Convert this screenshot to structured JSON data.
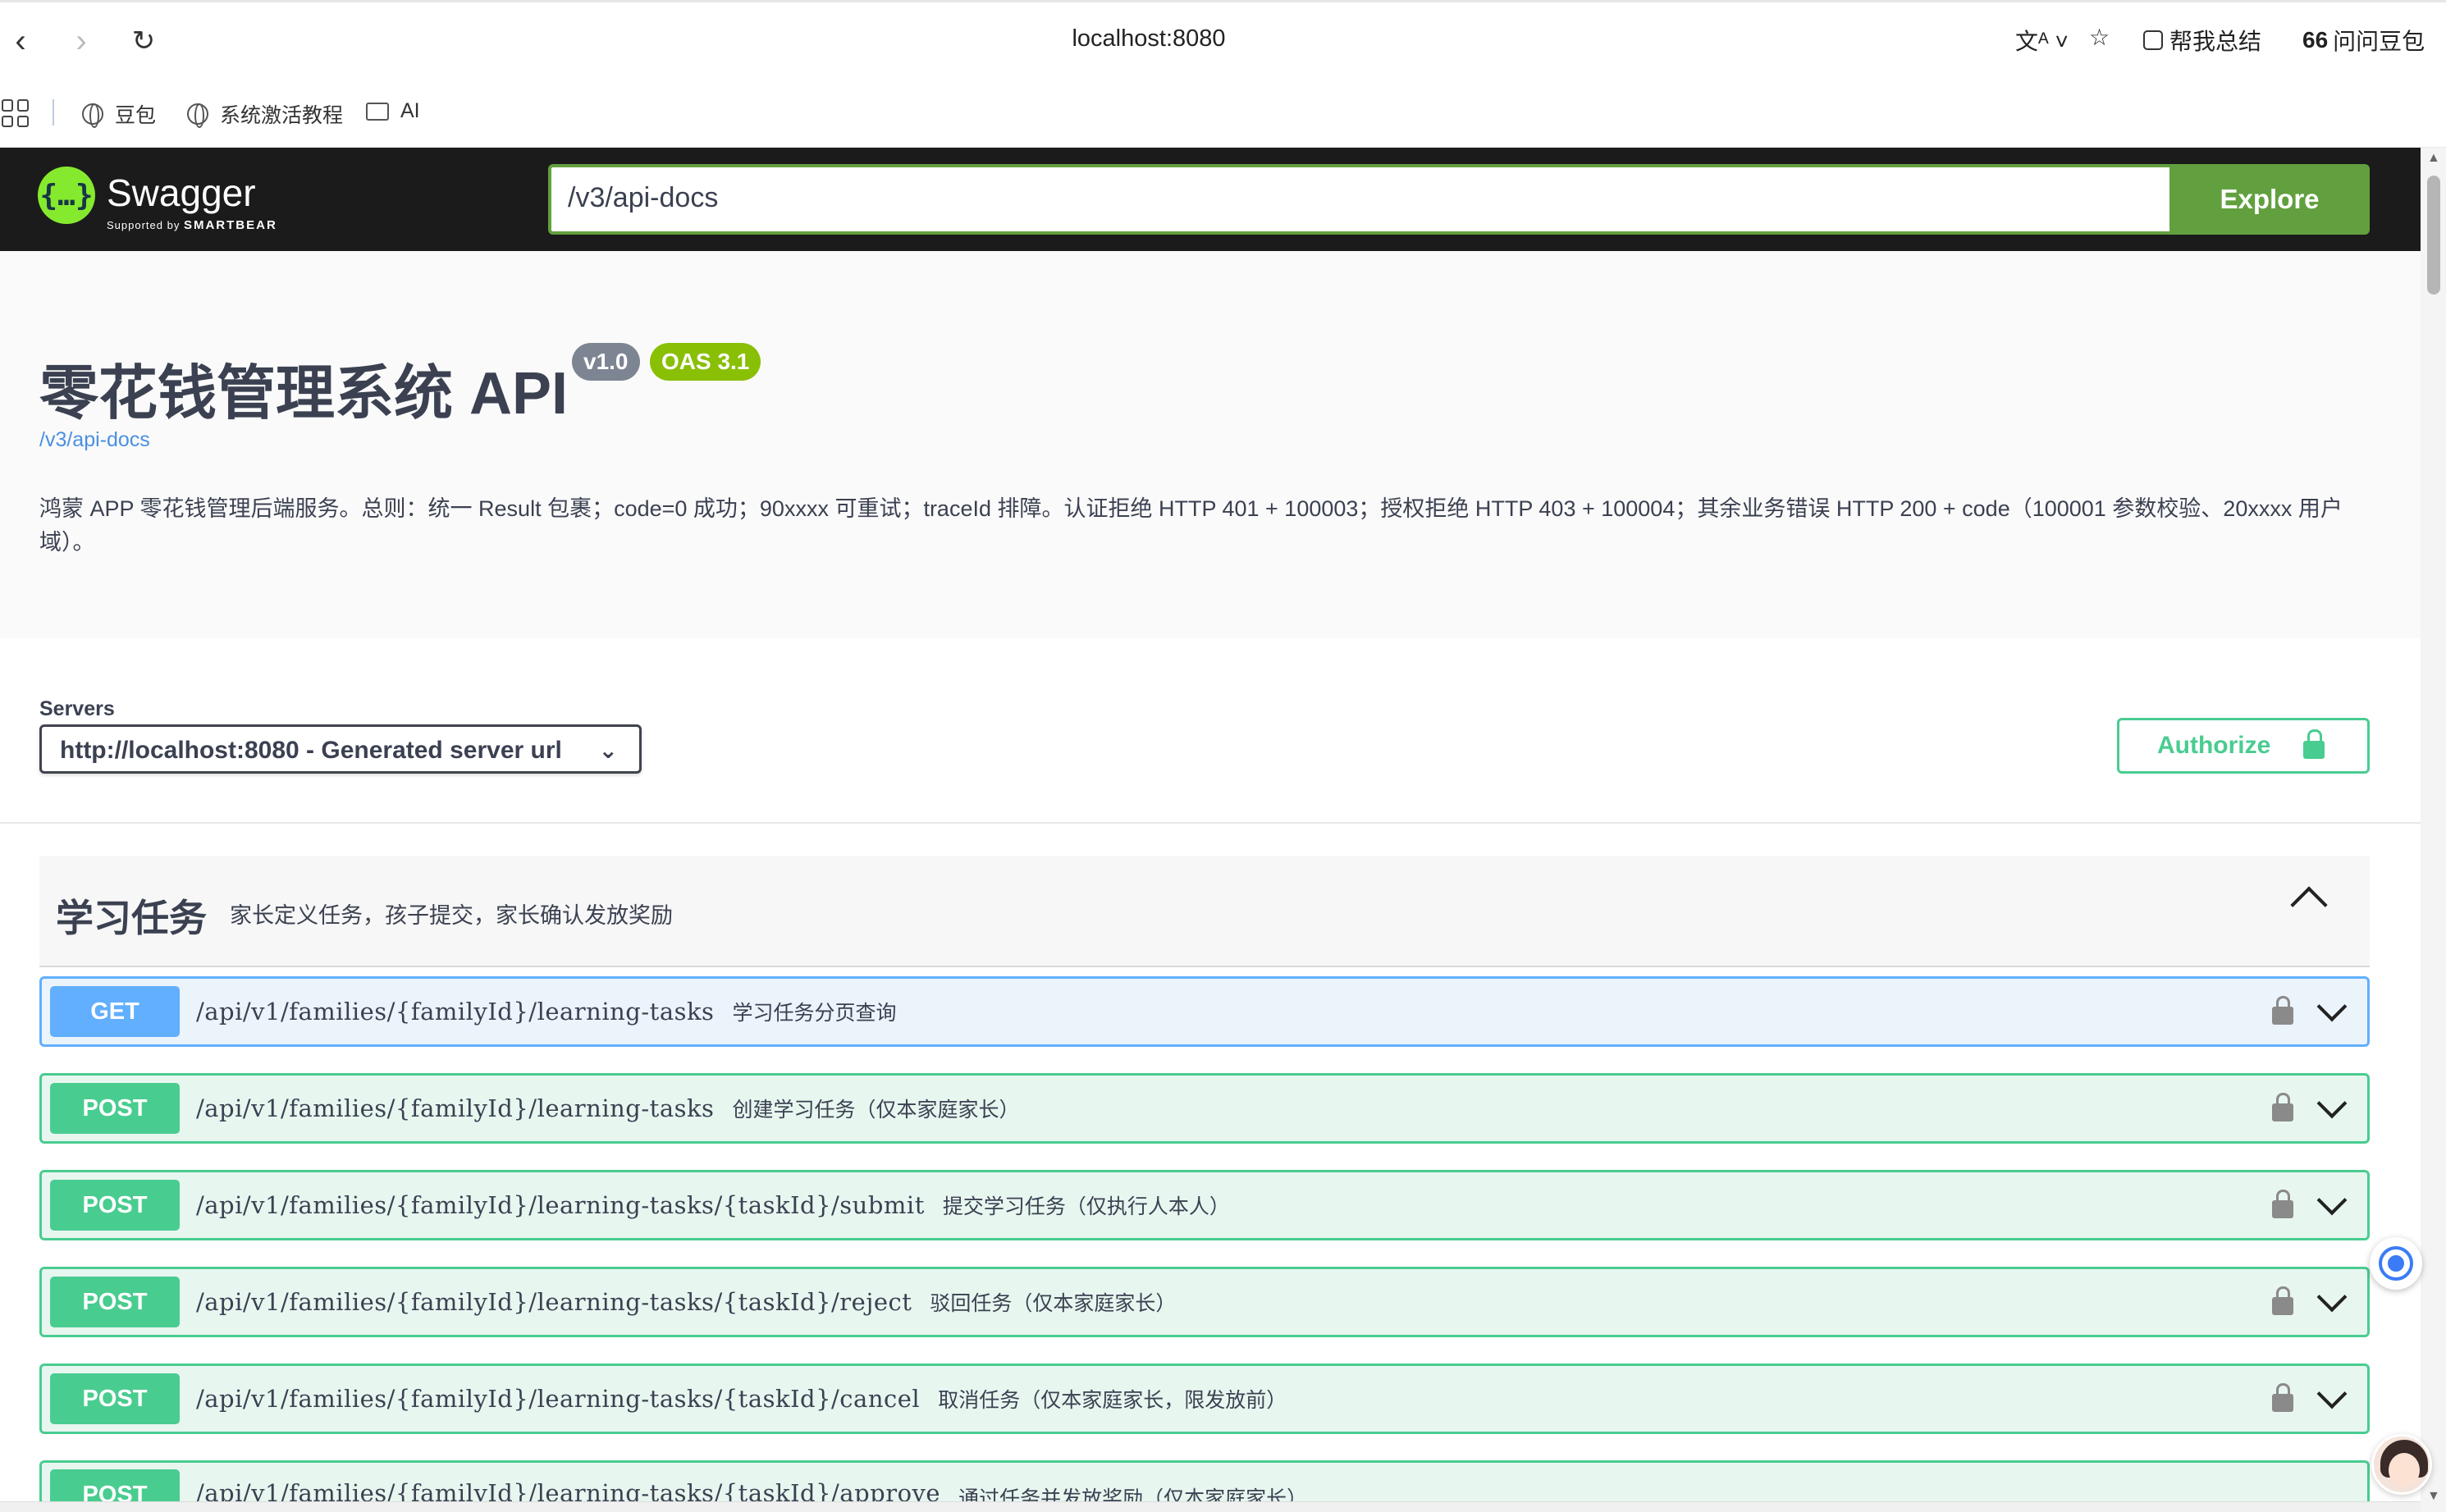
{
  "browser": {
    "url": "localhost:8080",
    "summarize_label": "帮我总结",
    "ask_label": "问问豆包",
    "bookmarks": [
      "豆包",
      "系统激活教程",
      "AI"
    ]
  },
  "topbar": {
    "logo_text": "Swagger",
    "logo_sub_prefix": "Supported by",
    "logo_sub_brand": "SMARTBEAR",
    "url_value": "/v3/api-docs",
    "explore_label": "Explore"
  },
  "info": {
    "title": "零花钱管理系统 API",
    "version": "v1.0",
    "oas": "OAS 3.1",
    "docs_link": "/v3/api-docs",
    "description": "鸿蒙 APP 零花钱管理后端服务。总则：统一 Result 包裹；code=0 成功；90xxxx 可重试；traceId 排障。认证拒绝 HTTP 401 + 100003；授权拒绝 HTTP 403 + 100004；其余业务错误 HTTP 200 + code（100001 参数校验、20xxxx 用户域）。"
  },
  "servers": {
    "label": "Servers",
    "selected": "http://localhost:8080 - Generated server url",
    "authorize_label": "Authorize"
  },
  "tag": {
    "name": "学习任务",
    "description": "家长定义任务，孩子提交，家长确认发放奖励"
  },
  "operations": [
    {
      "method": "GET",
      "path": "/api/v1/families/{familyId}/learning-tasks",
      "summary": "学习任务分页查询"
    },
    {
      "method": "POST",
      "path": "/api/v1/families/{familyId}/learning-tasks",
      "summary": "创建学习任务（仅本家庭家长）"
    },
    {
      "method": "POST",
      "path": "/api/v1/families/{familyId}/learning-tasks/{taskId}/submit",
      "summary": "提交学习任务（仅执行人本人）"
    },
    {
      "method": "POST",
      "path": "/api/v1/families/{familyId}/learning-tasks/{taskId}/reject",
      "summary": "驳回任务（仅本家庭家长）"
    },
    {
      "method": "POST",
      "path": "/api/v1/families/{familyId}/learning-tasks/{taskId}/cancel",
      "summary": "取消任务（仅本家庭家长，限发放前）"
    },
    {
      "method": "POST",
      "path": "/api/v1/families/{familyId}/learning-tasks/{taskId}/approve",
      "summary": "通过任务并发放奖励（仅本家庭家长）"
    }
  ],
  "colors": {
    "get": "#61affe",
    "post": "#49cc90",
    "swagger_green": "#85ea2d",
    "explore": "#62a03f"
  }
}
